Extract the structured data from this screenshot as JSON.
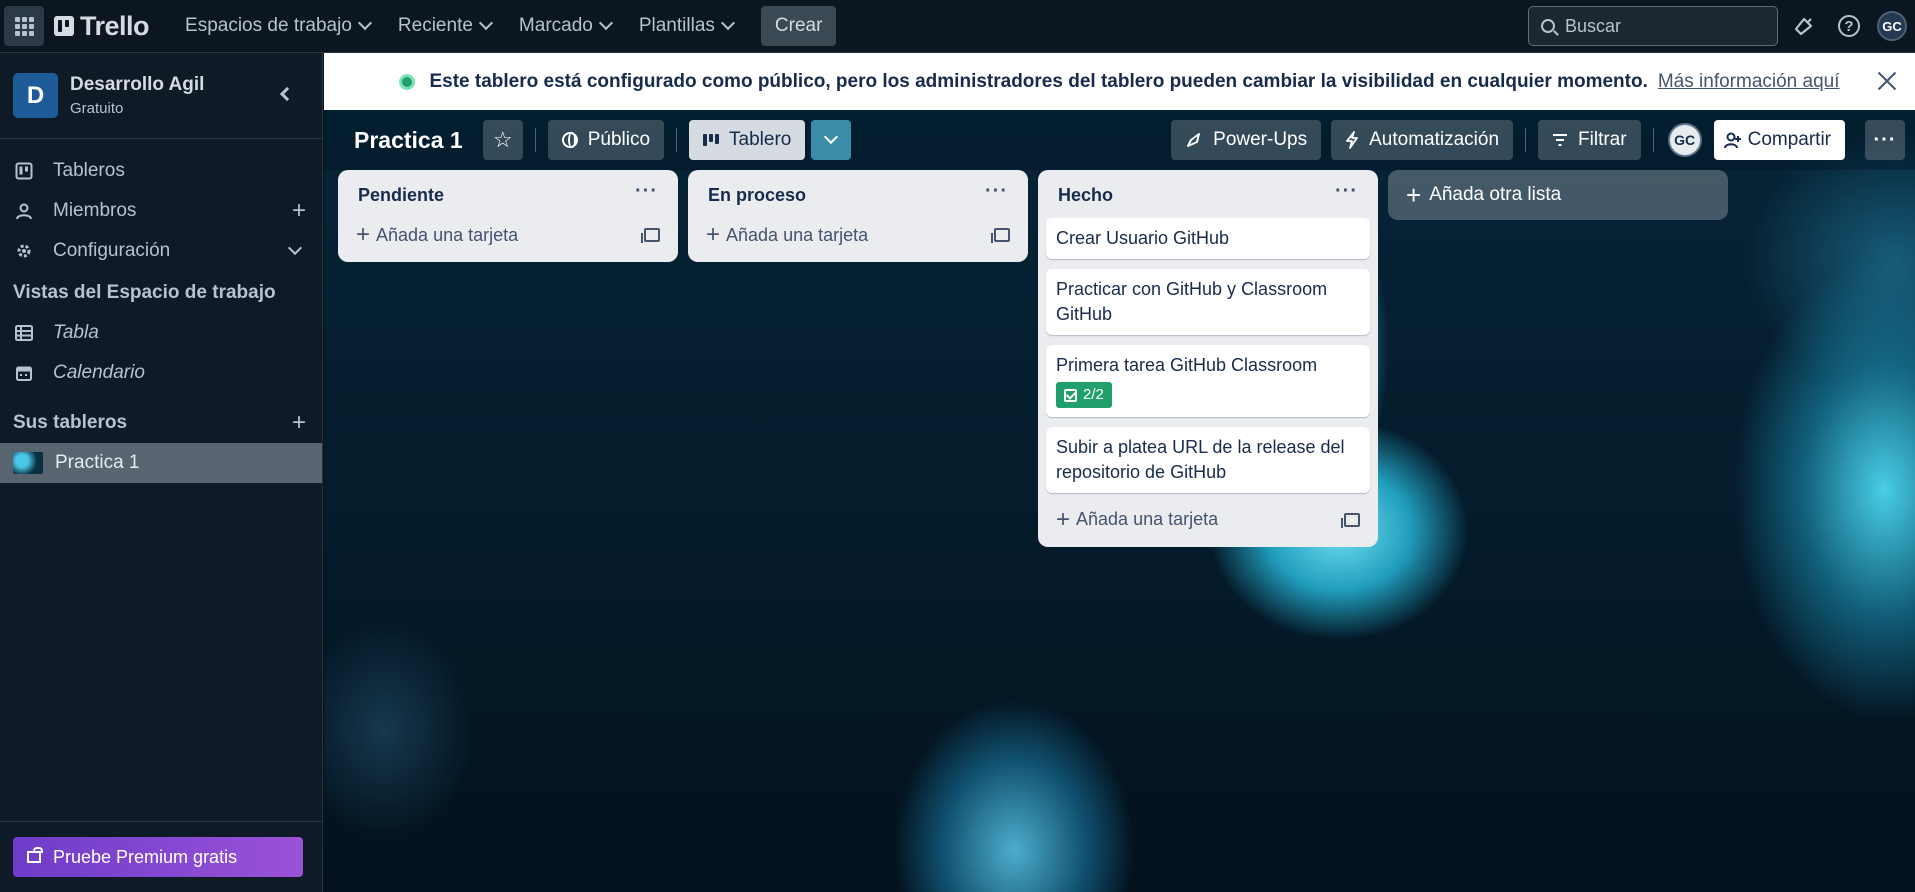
{
  "topnav": {
    "logo": "Trello",
    "items": [
      {
        "label": "Espacios de trabajo"
      },
      {
        "label": "Reciente"
      },
      {
        "label": "Marcado"
      },
      {
        "label": "Plantillas"
      }
    ],
    "create": "Crear",
    "search_placeholder": "Buscar",
    "avatar": "GC"
  },
  "sidebar": {
    "workspace_initial": "D",
    "workspace_name": "Desarrollo Agil",
    "workspace_plan": "Gratuito",
    "items": [
      {
        "label": "Tableros",
        "icon": "board-icon"
      },
      {
        "label": "Miembros",
        "icon": "person-icon",
        "action": "+"
      },
      {
        "label": "Configuración",
        "icon": "gear-icon",
        "action": "chevron-down"
      }
    ],
    "views_heading": "Vistas del Espacio de trabajo",
    "views": [
      {
        "label": "Tabla",
        "icon": "table-icon"
      },
      {
        "label": "Calendario",
        "icon": "calendar-icon"
      }
    ],
    "boards_heading": "Sus tableros",
    "boards": [
      {
        "label": "Practica 1"
      }
    ],
    "premium": "Pruebe Premium gratis"
  },
  "banner": {
    "message": "Este tablero está configurado como público, pero los administradores del tablero pueden cambiar la visibilidad en cualquier momento.",
    "link": "Más información aquí"
  },
  "board": {
    "title": "Practica 1",
    "visibility": "Público",
    "view": "Tablero",
    "powerups": "Power-Ups",
    "automation": "Automatización",
    "filter": "Filtrar",
    "member_avatar": "GC",
    "share": "Compartir",
    "more": "···",
    "lists": [
      {
        "title": "Pendiente",
        "cards": [],
        "add": "Añada una tarjeta"
      },
      {
        "title": "En proceso",
        "cards": [],
        "add": "Añada una tarjeta"
      },
      {
        "title": "Hecho",
        "cards": [
          {
            "title": "Crear Usuario GitHub"
          },
          {
            "title": "Practicar con GitHub y Classroom GitHub"
          },
          {
            "title": "Primera tarea GitHub Classroom",
            "checklist": "2/2"
          },
          {
            "title": "Subir a platea URL de la release del repositorio de GitHub"
          }
        ],
        "add": "Añada una tarjeta"
      }
    ],
    "add_list": "Añada otra lista"
  },
  "colors": {
    "topbar": "#0b1620",
    "sidebar": "#0e1a26",
    "workspace_badge": "#1e5c99",
    "checklist_complete": "#22a06b",
    "premium_gradient_start": "#6e3cc9",
    "premium_gradient_end": "#9a52d8"
  }
}
